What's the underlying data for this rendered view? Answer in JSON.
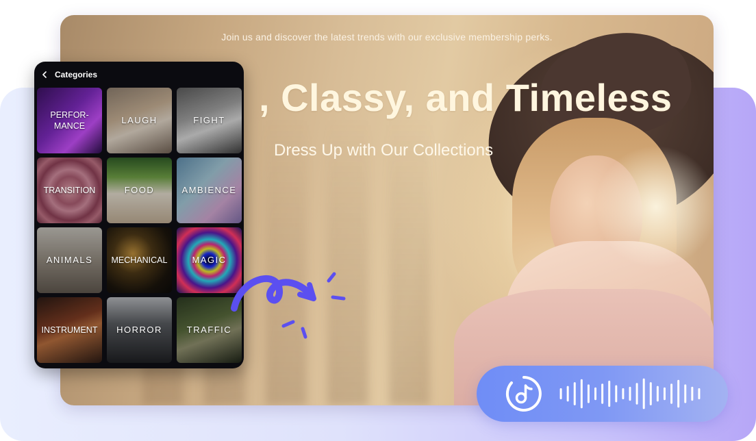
{
  "banner": {
    "tagline": "Join us and discover the latest trends with our exclusive membership perks.",
    "headline": ", Classy, and Timeless",
    "subheadline": "Dress Up with Our Collections"
  },
  "panel": {
    "title": "Categories",
    "back_icon": "chevron-left-icon",
    "tiles": [
      {
        "label": "PERFOR-\nMANCE",
        "bg": "linear-gradient(135deg,#3a1260 0%,#7a2ab8 45%,#c04df0 70%,#2a0f4a 100%)",
        "tight": true
      },
      {
        "label": "LAUGH",
        "bg": "linear-gradient(160deg,#8a7b6c 0%,#bfa98f 40%,#d8cdbf 60%,#6e5f52 100%)"
      },
      {
        "label": "FIGHT",
        "bg": "linear-gradient(160deg,#5a5a5a 0%,#9a9a9a 40%,#d0d0d0 60%,#3c3c3c 100%)"
      },
      {
        "label": "TRANSITION",
        "bg": "radial-gradient(circle at 50% 50%,#d79aa5 0%,#a55a6e 30%,#c98899 45%,#8a3f55 65%,#b86f80 80%,#6a2c40 100%)",
        "tight": true
      },
      {
        "label": "FOOD",
        "bg": "linear-gradient(180deg,#2f5a26 0%,#6c9a44 30%,#d9d2c4 55%,#b7a58e 100%)"
      },
      {
        "label": "AMBIENCE",
        "bg": "linear-gradient(135deg,#5e8aa8 0%,#9ec0cf 40%,#c8a0c8 70%,#7a6aa2 100%)"
      },
      {
        "label": "ANIMALS",
        "bg": "linear-gradient(180deg,#bcb9b2 0%,#8d857a 50%,#5d554c 100%)"
      },
      {
        "label": "MECHANICAL",
        "bg": "radial-gradient(circle at 40% 40%,#b88a3a 0%,#4a3616 35%,#1a140c 70%,#0c0a08 100%)",
        "tight": true
      },
      {
        "label": "MAGIC",
        "bg": "radial-gradient(circle at 50% 50%,#000 0%,#1b2cf2 15%,#e4e42a 25%,#e02a8a 35%,#2ad0e0 45%,#5a1aa8 60%,#ff3a6a 75%,#1a1a70 100%)"
      },
      {
        "label": "INSTRUMENT",
        "bg": "linear-gradient(160deg,#2a1a14 0%,#7a3a22 40%,#b06a3c 55%,#2a1a14 100%)",
        "tight": true
      },
      {
        "label": "HORROR",
        "bg": "linear-gradient(180deg,#aeb0b4 0%,#55585c 40%,#1e1f22 100%)"
      },
      {
        "label": "TRAFFIC",
        "bg": "linear-gradient(160deg,#2c3a22 0%,#55663a 40%,#8a8a6a 60%,#1c2216 100%)"
      }
    ]
  },
  "audio": {
    "icon": "music-note-icon",
    "wave_icon": "sound-wave-icon",
    "bars": [
      0.3,
      0.45,
      0.7,
      0.9,
      0.55,
      0.35,
      0.6,
      0.8,
      0.5,
      0.3,
      0.4,
      0.65,
      0.95,
      0.7,
      0.45,
      0.35,
      0.6,
      0.85,
      0.55,
      0.4,
      0.3
    ]
  },
  "colors": {
    "accent": "#6f8df6",
    "arrow": "#5b4ff0",
    "panel_bg": "#0b0b10"
  }
}
